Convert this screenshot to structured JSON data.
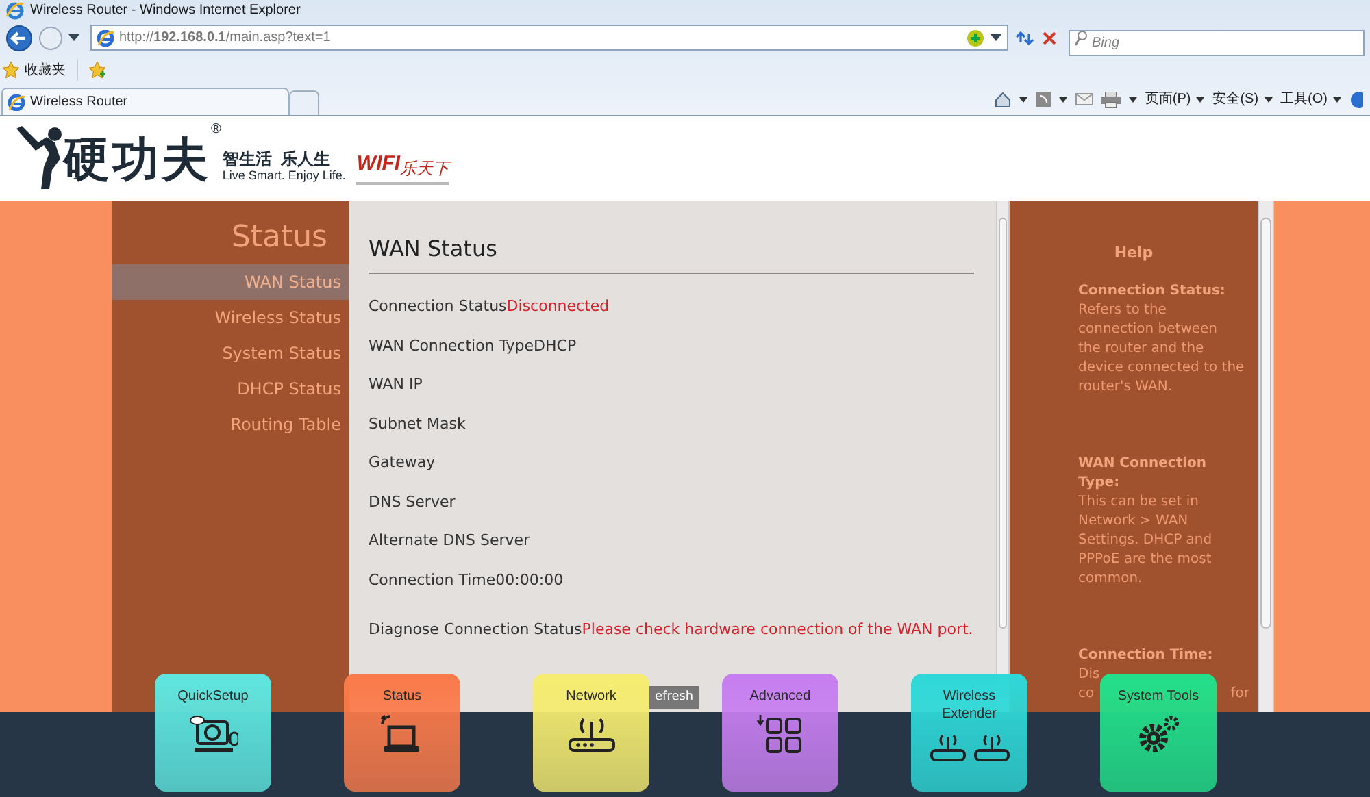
{
  "window": {
    "title": "Wireless Router - Windows Internet Explorer"
  },
  "address_bar": {
    "url": "http://**192.168.0.1**/main.asp?text=1",
    "search_placeholder": "Bing"
  },
  "favorites_bar": {
    "label": "收藏夹"
  },
  "tabs": [
    {
      "label": "Wireless Router",
      "selected": true
    }
  ],
  "command_bar": [
    "页面(P)",
    "安全(S)",
    "工具(O)"
  ],
  "header": {
    "brand": "硬功夫",
    "registered": "®",
    "slogan": "智生活  乐人生",
    "slogan_en": "Live Smart. Enjoy Life.",
    "wifi": "WIFI",
    "wifi_tag": "乐天下"
  },
  "sidebar": {
    "title": "Status",
    "items": [
      {
        "label": "WAN Status",
        "selected": true
      },
      {
        "label": "Wireless Status",
        "selected": false
      },
      {
        "label": "System Status",
        "selected": false
      },
      {
        "label": "DHCP Status",
        "selected": false
      },
      {
        "label": "Routing Table",
        "selected": false
      }
    ]
  },
  "content": {
    "title": "WAN Status",
    "rows": [
      {
        "label": "Connection Status",
        "value": "Disconnected",
        "alert": true
      },
      {
        "label": "WAN Connection Type",
        "value": "DHCP",
        "alert": false
      },
      {
        "label": "WAN IP"
      },
      {
        "label": "Subnet Mask"
      },
      {
        "label": "Gateway"
      },
      {
        "label": "DNS Server"
      },
      {
        "label": "Alternate DNS Server"
      },
      {
        "label": "Connection Time",
        "value": "00:00:00",
        "alert": false
      },
      {
        "label": "Diagnose Connection Status",
        "value": "Please check hardware connection of the WAN port.",
        "alert": true
      }
    ],
    "button": "efresh"
  },
  "help": {
    "title": "Help",
    "sections": [
      {
        "heading": "Connection Status:",
        "lines": [
          [
            "Refers to the"
          ],
          [
            "connection between"
          ],
          [
            "the router and the"
          ],
          [
            "device connected to the"
          ],
          [
            "router's WAN."
          ]
        ]
      },
      {
        "heading": "WAN Connection Type:",
        "lines": [
          [
            "This can be set in"
          ],
          [
            "Network > WAN"
          ],
          [
            "Settings. DHCP and"
          ],
          [
            "PPPoE are the most"
          ],
          [
            "common."
          ]
        ]
      },
      {
        "heading": "Connection Time:",
        "lines": [
          [
            "Dis"
          ],
          [
            "co",
            "for"
          ]
        ]
      }
    ]
  },
  "nav_tiles": [
    {
      "label": "QuickSetup",
      "kind": "quicksetup",
      "color": "#5ee6e0"
    },
    {
      "label": "Status",
      "kind": "status",
      "color": "#fa7a4a"
    },
    {
      "label": "Network",
      "kind": "network",
      "color": "#f5ec70"
    },
    {
      "label": "Advanced",
      "kind": "advanced",
      "color": "#c77ef0"
    },
    {
      "label": "Wireless Extender",
      "kind": "extender",
      "color": "#2ed8d8"
    },
    {
      "label": "System Tools",
      "kind": "tools",
      "color": "#22e08a"
    }
  ]
}
